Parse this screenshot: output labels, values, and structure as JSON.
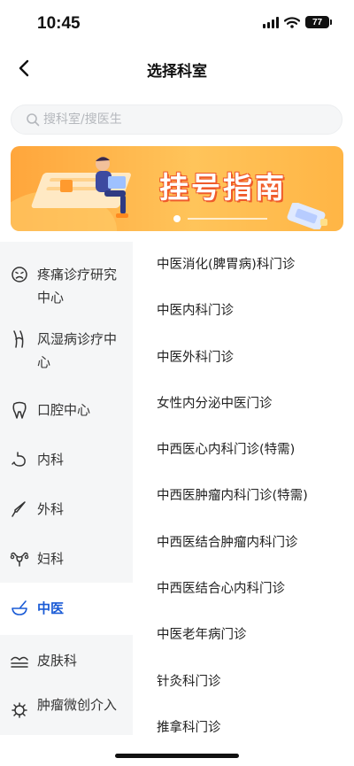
{
  "status_bar": {
    "time": "10:45",
    "battery": "77"
  },
  "header": {
    "title": "选择科室"
  },
  "search": {
    "placeholder": "搜科室/搜医生"
  },
  "banner": {
    "text": "挂号指南"
  },
  "sidebar": {
    "items": [
      {
        "label": "疼痛诊疗研究中心",
        "icon": "pain-face-icon"
      },
      {
        "label": "风湿病诊疗中心",
        "icon": "joint-icon"
      },
      {
        "label": "口腔中心",
        "icon": "tooth-icon"
      },
      {
        "label": "内科",
        "icon": "stomach-icon"
      },
      {
        "label": "外科",
        "icon": "scalpel-icon"
      },
      {
        "label": "妇科",
        "icon": "uterus-icon"
      },
      {
        "label": "中医",
        "icon": "mortar-icon",
        "active": true
      },
      {
        "label": "皮肤科",
        "icon": "skin-icon"
      },
      {
        "label": "肿瘤微创介入",
        "icon": "virus-icon"
      }
    ]
  },
  "departments": [
    "中医消化(脾胃病)科门诊",
    "中医内科门诊",
    "中医外科门诊",
    "女性内分泌中医门诊",
    "中西医心内科门诊(特需)",
    "中西医肿瘤内科门诊(特需)",
    "中西医结合肿瘤内科门诊",
    "中西医结合心内科门诊",
    "中医老年病门诊",
    "针灸科门诊",
    "推拿科门诊"
  ],
  "colors": {
    "accent": "#1a5bd6",
    "banner": "#ffb545",
    "sidebar_bg": "#f5f6f7"
  }
}
